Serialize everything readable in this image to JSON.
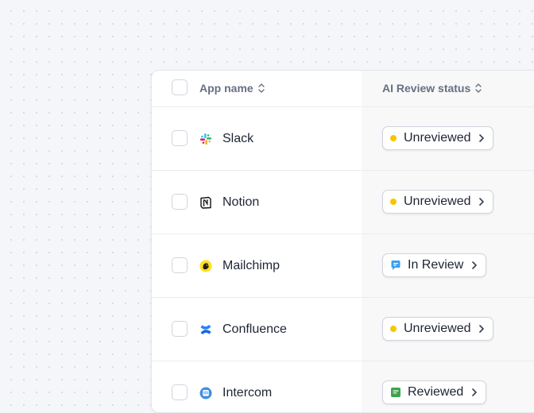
{
  "table": {
    "columns": {
      "app_name": "App name",
      "ai_review_status": "AI Review status"
    },
    "rows": [
      {
        "app": "Slack",
        "logo": "slack-logo",
        "status": "Unreviewed",
        "status_icon": "yellow-dot"
      },
      {
        "app": "Notion",
        "logo": "notion-logo",
        "status": "Unreviewed",
        "status_icon": "yellow-dot"
      },
      {
        "app": "Mailchimp",
        "logo": "mailchimp-logo",
        "status": "In Review",
        "status_icon": "chat-bubble-icon"
      },
      {
        "app": "Confluence",
        "logo": "confluence-logo",
        "status": "Unreviewed",
        "status_icon": "yellow-dot"
      },
      {
        "app": "Intercom",
        "logo": "intercom-logo",
        "status": "Reviewed",
        "status_icon": "document-check-icon"
      }
    ]
  },
  "colors": {
    "unreviewed_dot": "#f7c600",
    "in_review_icon": "#3b9ff0",
    "reviewed_icon": "#3fa34d",
    "header_text": "#667085",
    "body_text": "#1d2433"
  }
}
